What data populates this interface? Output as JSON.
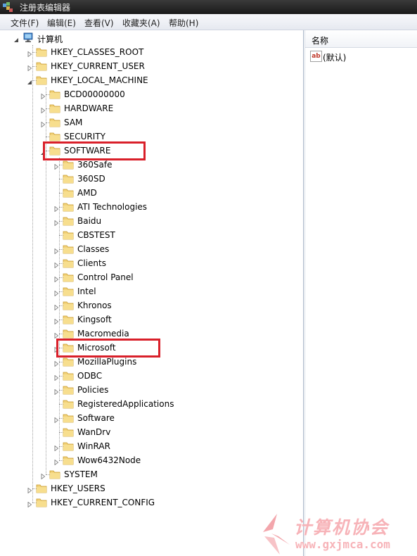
{
  "window": {
    "title": "注册表编辑器"
  },
  "menu": [
    "文件(F)",
    "编辑(E)",
    "查看(V)",
    "收藏夹(A)",
    "帮助(H)"
  ],
  "tree": [
    {
      "label": "计算机",
      "depth": 0,
      "expander": "expanded",
      "icon": "computer-icon"
    },
    {
      "label": "HKEY_CLASSES_ROOT",
      "depth": 1,
      "expander": "collapsed"
    },
    {
      "label": "HKEY_CURRENT_USER",
      "depth": 1,
      "expander": "collapsed"
    },
    {
      "label": "HKEY_LOCAL_MACHINE",
      "depth": 1,
      "expander": "expanded"
    },
    {
      "label": "BCD00000000",
      "depth": 2,
      "expander": "collapsed"
    },
    {
      "label": "HARDWARE",
      "depth": 2,
      "expander": "collapsed"
    },
    {
      "label": "SAM",
      "depth": 2,
      "expander": "collapsed"
    },
    {
      "label": "SECURITY",
      "depth": 2,
      "expander": "none"
    },
    {
      "label": "SOFTWARE",
      "depth": 2,
      "expander": "expanded",
      "highlighted": true
    },
    {
      "label": "360Safe",
      "depth": 3,
      "expander": "collapsed"
    },
    {
      "label": "360SD",
      "depth": 3,
      "expander": "none"
    },
    {
      "label": "AMD",
      "depth": 3,
      "expander": "none"
    },
    {
      "label": "ATI Technologies",
      "depth": 3,
      "expander": "collapsed"
    },
    {
      "label": "Baidu",
      "depth": 3,
      "expander": "collapsed"
    },
    {
      "label": "CBSTEST",
      "depth": 3,
      "expander": "none"
    },
    {
      "label": "Classes",
      "depth": 3,
      "expander": "collapsed"
    },
    {
      "label": "Clients",
      "depth": 3,
      "expander": "collapsed"
    },
    {
      "label": "Control Panel",
      "depth": 3,
      "expander": "collapsed"
    },
    {
      "label": "Intel",
      "depth": 3,
      "expander": "collapsed"
    },
    {
      "label": "Khronos",
      "depth": 3,
      "expander": "collapsed"
    },
    {
      "label": "Kingsoft",
      "depth": 3,
      "expander": "collapsed"
    },
    {
      "label": "Macromedia",
      "depth": 3,
      "expander": "collapsed"
    },
    {
      "label": "Microsoft",
      "depth": 3,
      "expander": "collapsed",
      "highlighted": true
    },
    {
      "label": "MozillaPlugins",
      "depth": 3,
      "expander": "collapsed"
    },
    {
      "label": "ODBC",
      "depth": 3,
      "expander": "collapsed"
    },
    {
      "label": "Policies",
      "depth": 3,
      "expander": "collapsed"
    },
    {
      "label": "RegisteredApplications",
      "depth": 3,
      "expander": "none"
    },
    {
      "label": "Software",
      "depth": 3,
      "expander": "collapsed"
    },
    {
      "label": "WanDrv",
      "depth": 3,
      "expander": "none"
    },
    {
      "label": "WinRAR",
      "depth": 3,
      "expander": "collapsed"
    },
    {
      "label": "Wow6432Node",
      "depth": 3,
      "expander": "collapsed"
    },
    {
      "label": "SYSTEM",
      "depth": 2,
      "expander": "collapsed"
    },
    {
      "label": "HKEY_USERS",
      "depth": 1,
      "expander": "collapsed"
    },
    {
      "label": "HKEY_CURRENT_CONFIG",
      "depth": 1,
      "expander": "collapsed"
    }
  ],
  "values_pane": {
    "column_header": "名称",
    "values": [
      {
        "name": "(默认)",
        "type_icon": "string-value-icon"
      }
    ]
  },
  "colors": {
    "highlight_box": "#d9202a",
    "folder": "#e8c15a"
  },
  "watermark": {
    "title": "计算机协会",
    "url": "www.gxjmca.com"
  }
}
